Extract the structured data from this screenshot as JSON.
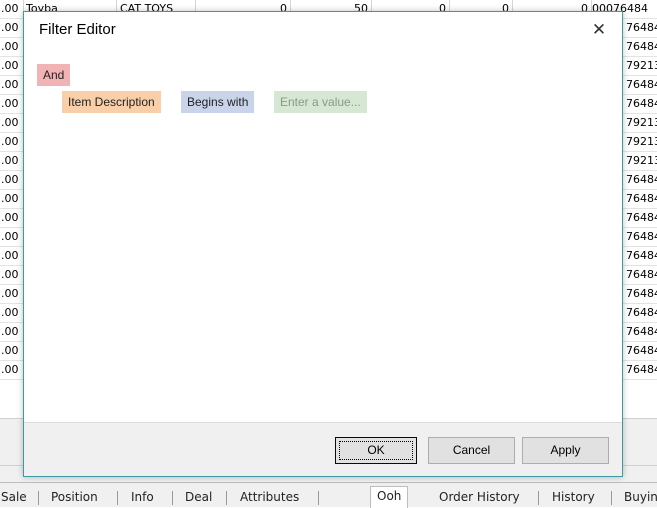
{
  "grid": {
    "top_row": {
      "c1": ".00",
      "c2": "Toyba",
      "c3": "CAT TOYS",
      "c4": "0",
      "c5": "50",
      "c6": "0",
      "c7": "0",
      "c8": "0",
      "c9": "00076484"
    },
    "rows": [
      {
        "left": ".00",
        "right": "76484"
      },
      {
        "left": ".00",
        "right": "76484"
      },
      {
        "left": ".00",
        "right": "79213"
      },
      {
        "left": ".00",
        "right": "76484"
      },
      {
        "left": ".00",
        "right": "76484"
      },
      {
        "left": ".00",
        "right": "79213"
      },
      {
        "left": ".00",
        "right": "79213"
      },
      {
        "left": ".00",
        "right": "79213"
      },
      {
        "left": ".00",
        "right": "76484"
      },
      {
        "left": ".00",
        "right": "76484"
      },
      {
        "left": ".00",
        "right": "76484"
      },
      {
        "left": ".00",
        "right": "76484"
      },
      {
        "left": ".00",
        "right": "76484"
      },
      {
        "left": ".00",
        "right": "76484"
      },
      {
        "left": ".00",
        "right": "76484"
      },
      {
        "left": ".00",
        "right": "76484"
      },
      {
        "left": ".00",
        "right": "76484"
      },
      {
        "left": ".00",
        "right": "76484"
      },
      {
        "left": ".00",
        "right": "76484"
      }
    ]
  },
  "tabs": {
    "left": [
      "Sale",
      "Position",
      "Info",
      "Deal",
      "Attributes"
    ],
    "right": [
      "Ooh",
      "Order History",
      "History",
      "Buyin"
    ]
  },
  "dialog": {
    "title": "Filter Editor",
    "close_symbol": "✕",
    "group_operator": "And",
    "condition": {
      "field": "Item Description",
      "operator": "Begins with",
      "value_placeholder": "Enter a value..."
    },
    "buttons": {
      "ok": "OK",
      "cancel": "Cancel",
      "apply": "Apply"
    }
  },
  "colors": {
    "and_chip": "#f1b3b3",
    "field_chip": "#f8cfa8",
    "operator_chip": "#c9d3ea",
    "value_chip": "#d6e7d3",
    "dialog_border": "#3c9aa6"
  }
}
